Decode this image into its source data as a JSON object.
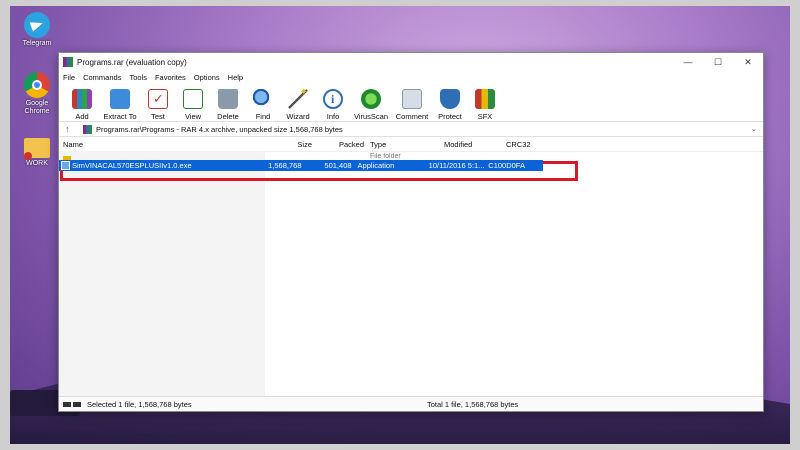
{
  "desktop": {
    "icons": [
      {
        "label": "Telegram",
        "icon": "telegram-icon"
      },
      {
        "label": "Google Chrome",
        "icon": "chrome-icon"
      },
      {
        "label": "WORK",
        "icon": "folder-icon"
      }
    ]
  },
  "window": {
    "title": "Programs.rar (evaluation copy)",
    "controls": {
      "minimize": "—",
      "maximize": "☐",
      "close": "✕"
    }
  },
  "menu": [
    "File",
    "Commands",
    "Tools",
    "Favorites",
    "Options",
    "Help"
  ],
  "toolbar": [
    {
      "label": "Add",
      "icon": "add-books-icon"
    },
    {
      "label": "Extract To",
      "icon": "extract-folder-icon"
    },
    {
      "label": "Test",
      "icon": "test-checklist-icon"
    },
    {
      "label": "View",
      "icon": "view-book-icon"
    },
    {
      "label": "Delete",
      "icon": "trash-icon"
    },
    {
      "label": "Find",
      "icon": "magnifier-icon"
    },
    {
      "label": "Wizard",
      "icon": "magic-wand-icon"
    },
    {
      "label": "Info",
      "icon": "info-icon"
    },
    {
      "label": "VirusScan",
      "icon": "virus-scan-icon"
    },
    {
      "label": "Comment",
      "icon": "comment-icon"
    },
    {
      "label": "Protect",
      "icon": "shield-icon"
    },
    {
      "label": "SFX",
      "icon": "sfx-archive-icon"
    }
  ],
  "address": {
    "up": "↑",
    "path": "Programs.rar\\Programs - RAR 4.x archive, unpacked size 1,568,768 bytes",
    "dropdown": "⌄"
  },
  "columns": {
    "name": "Name",
    "size": "Size",
    "packed": "Packed",
    "type": "Type",
    "modified": "Modified",
    "crc": "CRC32"
  },
  "folder_row": {
    "name": "..",
    "type": "File folder"
  },
  "files": [
    {
      "name": "SimVINACAL570ESPLUSIIv1.0.exe",
      "size": "1,568,768",
      "packed": "501,408",
      "type": "Application",
      "modified": "10/11/2016 5:1...",
      "crc": "C100D0FA"
    }
  ],
  "status": {
    "left": "Selected 1 file, 1,568,768 bytes",
    "right": "Total 1 file, 1,568,768 bytes"
  },
  "colors": {
    "selection": "#0a64d8",
    "highlight_box": "#d6182a"
  }
}
